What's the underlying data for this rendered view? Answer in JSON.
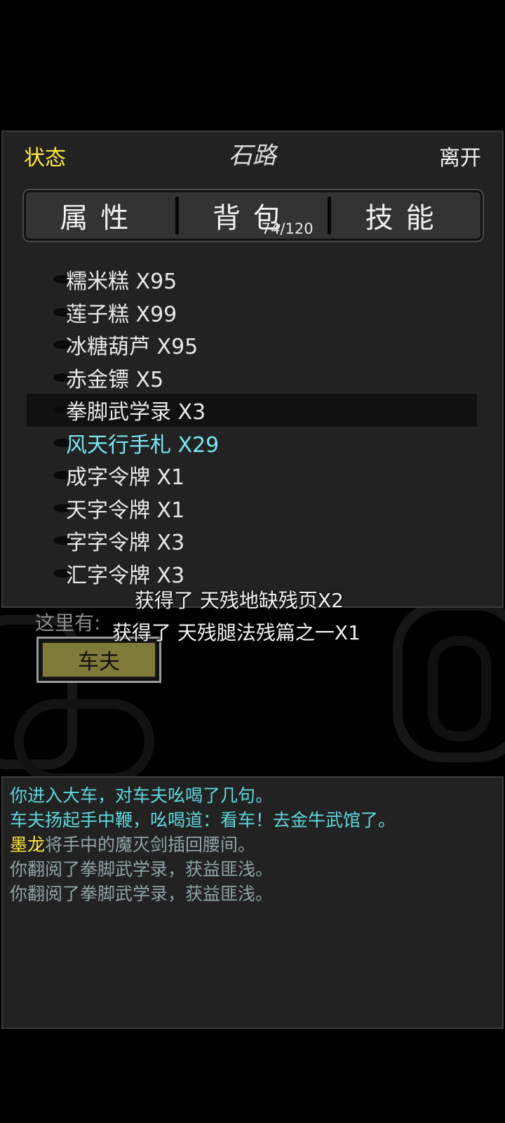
{
  "header": {
    "status_label": "状态",
    "location_title": "石路",
    "leave_label": "离开"
  },
  "tabs": [
    {
      "label": "属性"
    },
    {
      "label": "背包",
      "count": "74/120"
    },
    {
      "label": "技能"
    }
  ],
  "inventory": {
    "items": [
      {
        "text": "糯米糕 X95"
      },
      {
        "text": "莲子糕 X99"
      },
      {
        "text": "冰糖葫芦 X95"
      },
      {
        "text": "赤金镖 X5"
      },
      {
        "text": "拳脚武学录 X3"
      },
      {
        "text": "风天行手札 X29"
      },
      {
        "text": "成字令牌 X1"
      },
      {
        "text": "天字令牌 X1"
      },
      {
        "text": "字字令牌 X3"
      },
      {
        "text": "汇字令牌 X3"
      }
    ],
    "selected_index": 4,
    "highlight_index": 5,
    "highlight_color": "#7ae6f0"
  },
  "notifications": [
    "获得了 天残地缺残页X2",
    "获得了 天残腿法残篇之一X1"
  ],
  "here": {
    "label": "这里有:",
    "npc_button": "车夫"
  },
  "log": {
    "lines": [
      {
        "segments": [
          {
            "text": "你进入大车，对车夫吆喝了几句。",
            "color": "cyan"
          }
        ]
      },
      {
        "segments": [
          {
            "text": "车夫扬起手中鞭，吆喝道：看车！去金牛武馆了。",
            "color": "cyan"
          }
        ]
      },
      {
        "segments": [
          {
            "text": "墨龙",
            "color": "yellow"
          },
          {
            "text": "将手中的魔灭剑插回腰间。",
            "color": "grey"
          }
        ]
      },
      {
        "segments": [
          {
            "text": "你翻阅了拳脚武学录，获益匪浅。",
            "color": "grey"
          }
        ]
      },
      {
        "segments": [
          {
            "text": "你翻阅了拳脚武学录，获益匪浅。",
            "color": "grey"
          }
        ]
      }
    ]
  },
  "colors": {
    "status_yellow": "#ffea3a",
    "log_cyan": "#5ed6dc",
    "log_grey": "#8fa3a6",
    "npc_button_bg": "#807a3a"
  }
}
